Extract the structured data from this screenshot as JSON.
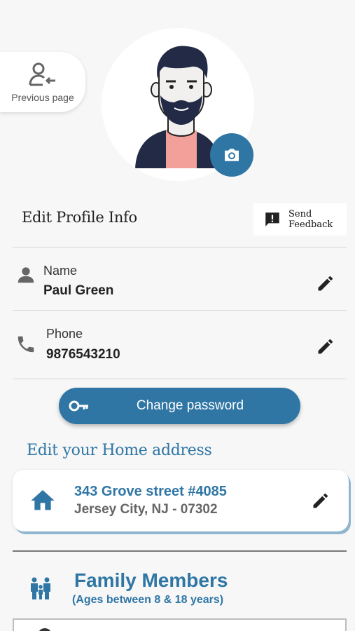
{
  "nav": {
    "previous_label": "Previous page"
  },
  "profile": {
    "section_title": "Edit Profile Info",
    "feedback_label_line1": "Send",
    "feedback_label_line2": "Feedback",
    "fields": [
      {
        "label": "Name",
        "value": "Paul Green",
        "icon": "person-icon"
      },
      {
        "label": "Phone",
        "value": "9876543210",
        "icon": "phone-icon"
      }
    ],
    "change_password_label": "Change password"
  },
  "address": {
    "section_title": "Edit your Home address",
    "line1": "343 Grove street #4085",
    "line2": "Jersey City, NJ - 07302",
    "icon": "home-icon"
  },
  "family": {
    "title": "Family Members",
    "subtitle": "(Ages between 8 & 18 years)",
    "icon": "family-icon"
  },
  "colors": {
    "accent": "#2f76a5",
    "background": "#f7f7f7"
  }
}
